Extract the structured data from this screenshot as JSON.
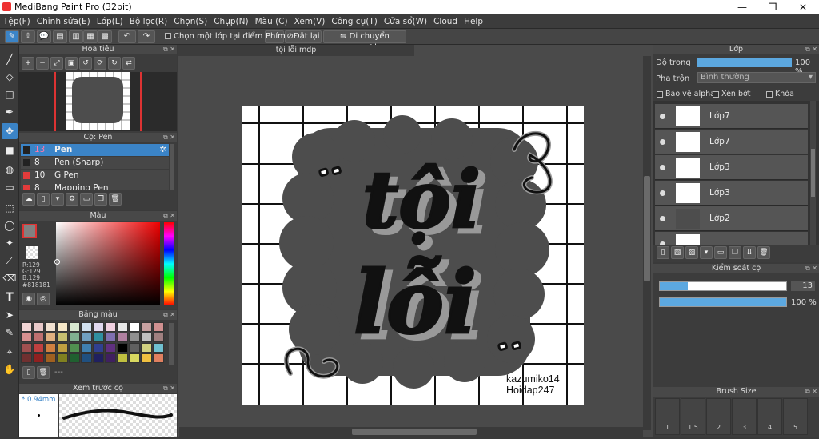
{
  "window": {
    "title": "MediBang Paint Pro (32bit)",
    "min": "—",
    "max": "❐",
    "close": "✕"
  },
  "menu": [
    "Tệp(F)",
    "Chỉnh sửa(E)",
    "Lớp(L)",
    "Bộ lọc(R)",
    "Chọn(S)",
    "Chụp(N)",
    "Màu (C)",
    "Xem(V)",
    "Công cụ(T)",
    "Cửa sổ(W)",
    "Cloud",
    "Help"
  ],
  "toolbar": {
    "select_layer": "Chọn một lớp tại điểm nhấp",
    "key_label": "Phím",
    "reset": "Đặt lại",
    "flip": "Di chuyển ngang/dọc"
  },
  "navigator": {
    "title": "Hoa tiêu"
  },
  "brush": {
    "title": "Cọ: Pen",
    "items": [
      {
        "size": "13",
        "name": "Pen",
        "color": "#222222"
      },
      {
        "size": "8",
        "name": "Pen (Sharp)",
        "color": "#222222"
      },
      {
        "size": "10",
        "name": "G Pen",
        "color": "#e23b3b"
      },
      {
        "size": "8",
        "name": "Mapping Pen",
        "color": "#e23b3b"
      }
    ]
  },
  "color": {
    "title": "Màu",
    "r": "R:129",
    "g": "G:129",
    "b": "B:129",
    "hex": "#818181"
  },
  "palette": {
    "title": "Bảng màu",
    "more": "---"
  },
  "preview": {
    "title": "Xem trước cọ",
    "size": "* 0.94mm"
  },
  "canvas": {
    "tab": "tội lỗi.mdp",
    "line1": "tội",
    "line2": "lỗi",
    "credit1": "kazumiko14",
    "credit2": "Hoidap247"
  },
  "layer": {
    "title": "Lớp",
    "opacity_label": "Độ trong",
    "opacity_value": "100 %",
    "opacity_pct": 100,
    "blend_label": "Pha trộn",
    "blend_value": "Bình thường",
    "protect_alpha": "Bảo vệ alpha",
    "clip": "Xén bớt",
    "lock": "Khóa",
    "items": [
      "Lớp7",
      "Lớp7",
      "Lớp3",
      "Lớp3",
      "Lớp2"
    ]
  },
  "brushctrl": {
    "title": "Kiểm soát cọ",
    "size_value": "13",
    "size_pct": 0.22,
    "opacity_value": "100 %",
    "opacity_pct": 1.0
  },
  "brushsize": {
    "title": "Brush Size",
    "sizes": [
      "1",
      "1.5",
      "2",
      "3",
      "4",
      "5"
    ]
  },
  "colors": {
    "accent": "#3b84c7",
    "panel": "#3c3c3c",
    "bg": "#4a4a4a"
  }
}
